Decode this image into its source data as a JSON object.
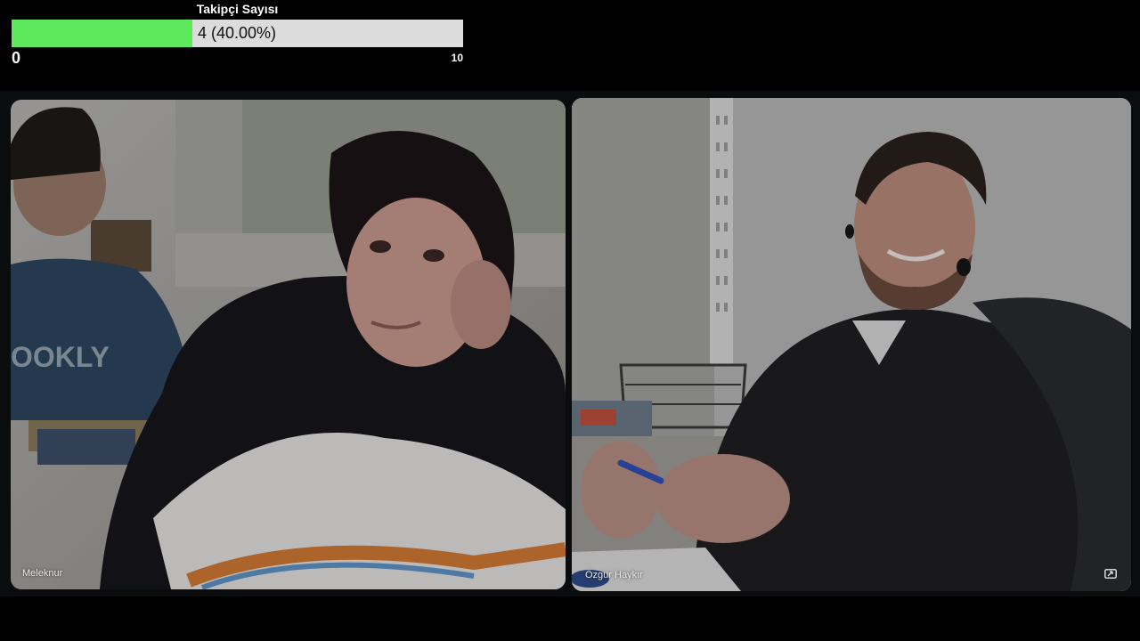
{
  "follower_counter": {
    "title": "Takipçi Sayısı",
    "current": 4,
    "max": 10,
    "percent_label": "4 (40.00%)",
    "progress_fraction": 0.4,
    "min_label": "0",
    "max_label": "10",
    "fill_color": "#5cea5c",
    "track_color": "#dcdcdc"
  },
  "participants": [
    {
      "name": "Meleknur",
      "active_speaker": false
    },
    {
      "name": "Özgür Haykır",
      "active_speaker": true,
      "icon": "expand-icon"
    }
  ],
  "colors": {
    "stage_background": "#0b0c0d",
    "active_speaker_border": "#a9c3dc"
  }
}
